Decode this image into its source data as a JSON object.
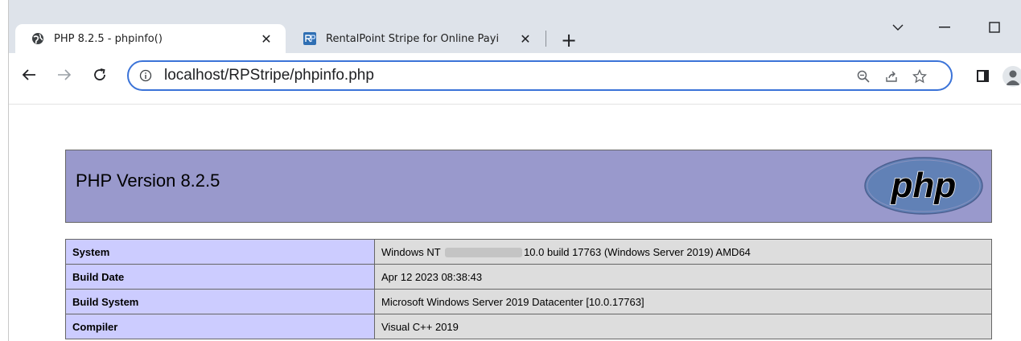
{
  "browser": {
    "tabs": [
      {
        "title": "PHP 8.2.5 - phpinfo()",
        "favicon": "globe-icon",
        "active": true
      },
      {
        "title": "RentalPoint Stripe for Online Payi",
        "favicon": "rp-logo-icon",
        "active": false
      }
    ],
    "tab_close_glyph": "✕",
    "new_tab_glyph": "+",
    "url": "localhost/RPStripe/phpinfo.php",
    "accent_color": "#3b73d8"
  },
  "page": {
    "header_title": "PHP Version 8.2.5",
    "logo_text": "php",
    "header_bg": "#9999cc",
    "rows": [
      {
        "key": "System",
        "value_before": "Windows NT",
        "value_after": "10.0 build 17763 (Windows Server 2019) AMD64"
      },
      {
        "key": "Build Date",
        "value": "Apr 12 2023 08:38:43"
      },
      {
        "key": "Build System",
        "value": "Microsoft Windows Server 2019 Datacenter [10.0.17763]"
      },
      {
        "key": "Compiler",
        "value": "Visual C++ 2019"
      }
    ]
  }
}
